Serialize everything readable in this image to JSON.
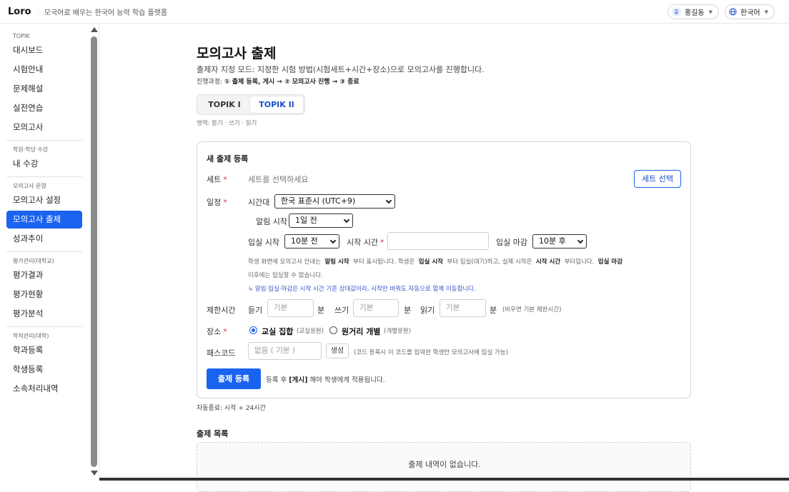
{
  "topbar": {
    "brand": "Loro",
    "separator": "·",
    "tagline": "모국어로 배우는 한국어 능력 학습 플랫폼",
    "user": {
      "avatar_initial": "홍",
      "name": "홍길동"
    },
    "language": "한국어"
  },
  "sidebar": {
    "sections": [
      {
        "label": "TOPIK",
        "items": [
          "대시보드",
          "시험안내",
          "문제해설",
          "실전연습",
          "모의고사"
        ]
      },
      {
        "label": "학원·학당 수강",
        "items": [
          "내 수강"
        ]
      },
      {
        "label": "모의고사 운영",
        "items": [
          "모의고사 설정",
          "모의고사 출제",
          "성과추이"
        ]
      },
      {
        "label": "평가관리(대학교)",
        "items": [
          "평가결과",
          "평가현황",
          "평가분석"
        ]
      },
      {
        "label": "학적관리(대학)",
        "items": [
          "학과등록",
          "학생등록",
          "소속처리내역"
        ]
      }
    ],
    "active_item": "모의고사 출제"
  },
  "main": {
    "title": "모의고사 출제",
    "description": "출제자 지정 모드: 지정한 시험 방법(시험세트+시간+장소)으로 모의고사를 진행합니다.",
    "flow_prefix": "진행과정: ",
    "flow_steps": "① 출제 등록, 게시 → ② 모의고사 진행 → ③ 종료",
    "tabs": [
      "TOPIK I",
      "TOPIK II"
    ],
    "active_tab": "TOPIK II",
    "areas": "영역: 듣기 · 쓰기 · 읽기",
    "form": {
      "title": "새 출제 등록",
      "set_label": "세트",
      "set_placeholder": "세트를 선택하세요",
      "set_button": "세트 선택",
      "schedule_label": "일정",
      "timezone_label": "시간대",
      "timezone_value": "한국 표준시 (UTC+9)",
      "notify_label": "알림 시작",
      "notify_value": "1일 전",
      "entry_start_label": "입실 시작",
      "entry_start_value": "10분 전",
      "start_time_label": "시작 시간",
      "entry_end_label": "입실 마감",
      "entry_end_value": "10분 후",
      "note_p1": "학생 화면에 모의고사 안내는",
      "note_b1": "알림 시작",
      "note_p2": "부터 표시됩니다. 학생은",
      "note_b2": "입실 시작",
      "note_p3": "부터 입실(대기)하고, 실제 시작은",
      "note_b3": "시작 시간",
      "note_p4": "부터입니다.",
      "note_b4": "입실 마감",
      "note_line2": "이후에는 입실할 수 없습니다.",
      "note_blue": "↳ 알림·입실·마감은 시작 시간 기준 상대값이라, 시작만 바꿔도 자동으로 함께 이동합니다.",
      "time_limit_label": "제한시간",
      "listening_label": "듣기",
      "writing_label": "쓰기",
      "reading_label": "읽기",
      "default_placeholder": "기본",
      "minute_unit": "분",
      "time_limit_hint": "(비우면 기본 제한시간)",
      "place_label": "장소",
      "place_option1": "교실 집합",
      "place_option1_sub": "(교실응원)",
      "place_option2": "원거리 개별",
      "place_option2_sub": "(개별응원)",
      "passcode_label": "패스코드",
      "passcode_placeholder": "없음 ( 기본 )",
      "generate_button": "생성",
      "passcode_hint": "(코드 등록시 이 코드를 입력한 학생만 모의고사에 입실 가능)",
      "submit_button": "출제 등록",
      "submit_note_p1": "등록 후",
      "submit_note_b": "[게시]",
      "submit_note_p2": "해야 학생에게 적용됩니다."
    },
    "auto_end": "자동종료: 시작 + 24시간",
    "list_title": "출제 목록",
    "empty_message": "출제 내역이 없습니다."
  },
  "colors": {
    "primary": "#1a63f0",
    "required": "#e03030"
  }
}
